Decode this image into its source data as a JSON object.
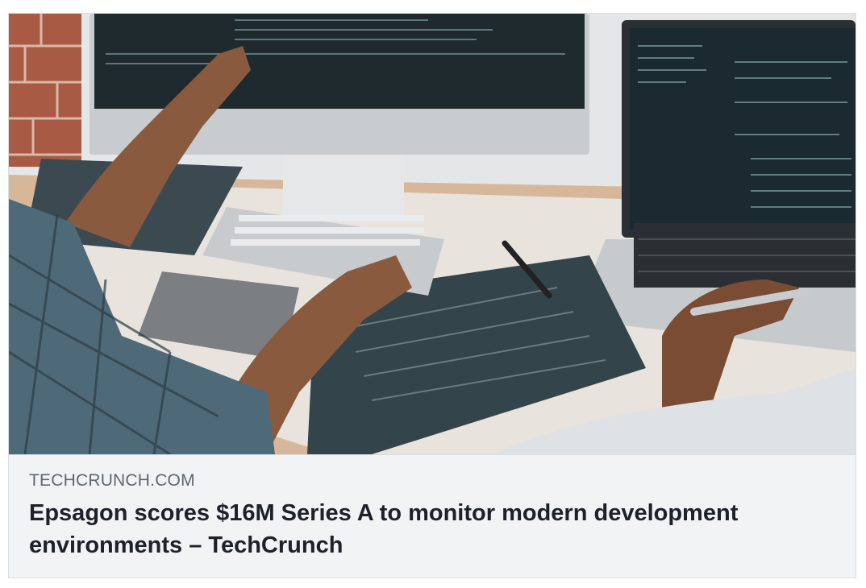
{
  "link_card": {
    "domain": "TECHCRUNCH.COM",
    "title": "Epsagon scores $16M Series A to monitor modern development environments – TechCrunch",
    "image_description": "developers-coding-desk-photo"
  },
  "colors": {
    "card_background": "#f2f3f5",
    "card_border": "#dadde1",
    "domain_text": "#606770",
    "title_text": "#1d2129"
  }
}
